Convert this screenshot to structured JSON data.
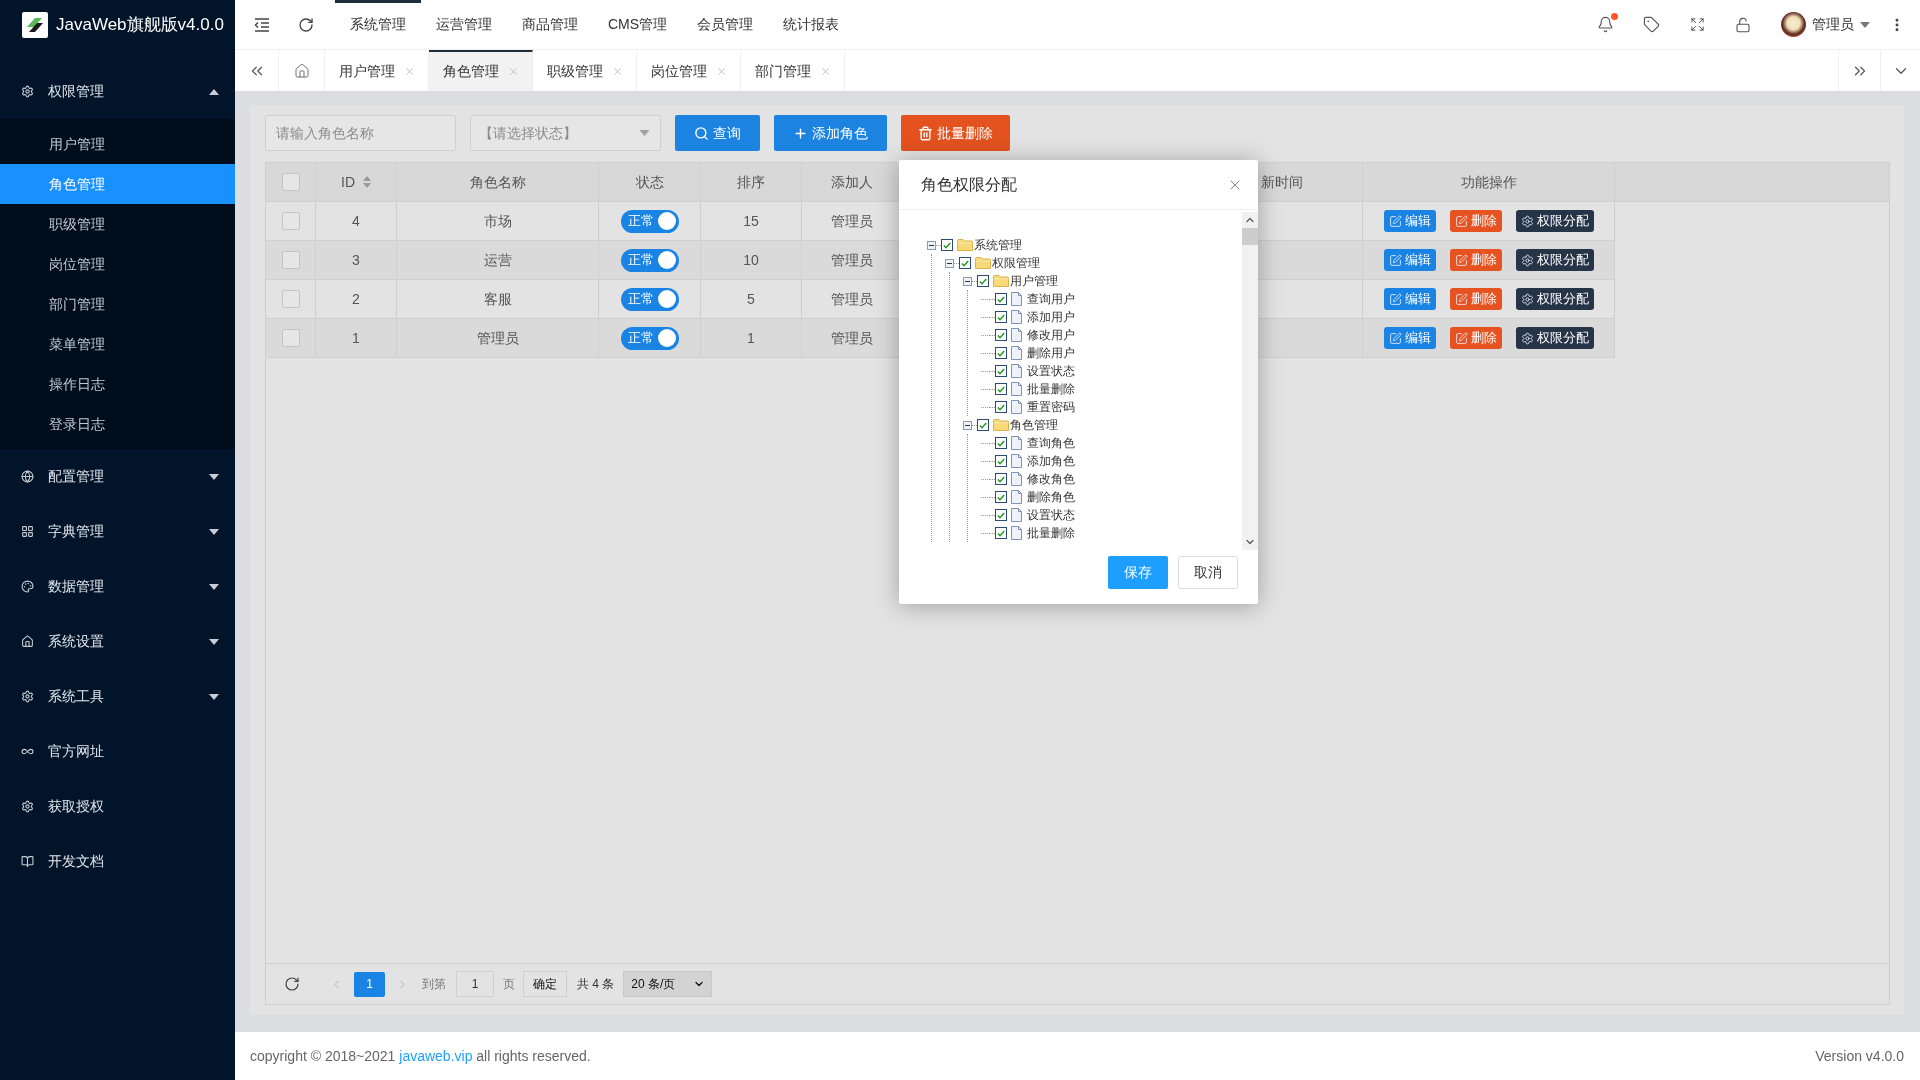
{
  "app": {
    "title": "JavaWeb旗舰版v4.0.0"
  },
  "sidebar": {
    "items": [
      {
        "label": "权限管理",
        "kind": "group",
        "expanded": true,
        "children": [
          {
            "label": "用户管理",
            "selected": false
          },
          {
            "label": "角色管理",
            "selected": true
          },
          {
            "label": "职级管理",
            "selected": false
          },
          {
            "label": "岗位管理",
            "selected": false
          },
          {
            "label": "部门管理",
            "selected": false
          },
          {
            "label": "菜单管理",
            "selected": false
          },
          {
            "label": "操作日志",
            "selected": false
          },
          {
            "label": "登录日志",
            "selected": false
          }
        ]
      },
      {
        "label": "配置管理",
        "kind": "group",
        "expanded": false
      },
      {
        "label": "字典管理",
        "kind": "group",
        "expanded": false
      },
      {
        "label": "数据管理",
        "kind": "group",
        "expanded": false
      },
      {
        "label": "系统设置",
        "kind": "group",
        "expanded": false
      },
      {
        "label": "系统工具",
        "kind": "group",
        "expanded": false
      },
      {
        "label": "官方网址",
        "kind": "link"
      },
      {
        "label": "获取授权",
        "kind": "link"
      },
      {
        "label": "开发文档",
        "kind": "link"
      }
    ]
  },
  "header": {
    "menu": [
      {
        "label": "系统管理",
        "selected": true
      },
      {
        "label": "运营管理",
        "selected": false
      },
      {
        "label": "商品管理",
        "selected": false
      },
      {
        "label": "CMS管理",
        "selected": false
      },
      {
        "label": "会员管理",
        "selected": false
      },
      {
        "label": "统计报表",
        "selected": false
      }
    ],
    "notifications": {
      "unread": true
    },
    "user": {
      "name": "管理员"
    }
  },
  "tabs": [
    {
      "label": "用户管理",
      "selected": false
    },
    {
      "label": "角色管理",
      "selected": true
    },
    {
      "label": "职级管理",
      "selected": false
    },
    {
      "label": "岗位管理",
      "selected": false
    },
    {
      "label": "部门管理",
      "selected": false
    }
  ],
  "toolbar": {
    "search": {
      "placeholder": "请输入角色名称"
    },
    "status": {
      "placeholder": "【请选择状态】"
    },
    "buttons": [
      {
        "label": "查询",
        "kind": "search"
      },
      {
        "label": "添加角色",
        "kind": "add"
      },
      {
        "label": "批量删除",
        "kind": "delete"
      }
    ]
  },
  "table": {
    "select_all": {
      "checked": false
    },
    "columns": [
      {
        "label": "ID",
        "sortable": true
      },
      {
        "label": "角色名称",
        "sortable": false
      },
      {
        "label": "状态",
        "sortable": false
      },
      {
        "label": "排序",
        "sortable": false
      },
      {
        "label": "添加人",
        "sortable": false
      },
      {
        "label": "新时间",
        "sortable": false
      },
      {
        "label": "功能操作",
        "sortable": false
      }
    ],
    "rows": [
      {
        "checked": false,
        "id": "4",
        "name": "市场",
        "status": {
          "label": "正常",
          "on": true
        },
        "sort": "15",
        "creator": "管理员",
        "actions": [
          {
            "label": "编辑",
            "kind": "edit"
          },
          {
            "label": "删除",
            "kind": "delete"
          },
          {
            "label": "权限分配",
            "kind": "permission"
          }
        ]
      },
      {
        "checked": false,
        "id": "3",
        "name": "运营",
        "status": {
          "label": "正常",
          "on": true
        },
        "sort": "10",
        "creator": "管理员",
        "actions": [
          {
            "label": "编辑",
            "kind": "edit"
          },
          {
            "label": "删除",
            "kind": "delete"
          },
          {
            "label": "权限分配",
            "kind": "permission"
          }
        ]
      },
      {
        "checked": false,
        "id": "2",
        "name": "客服",
        "status": {
          "label": "正常",
          "on": true
        },
        "sort": "5",
        "creator": "管理员",
        "actions": [
          {
            "label": "编辑",
            "kind": "edit"
          },
          {
            "label": "删除",
            "kind": "delete"
          },
          {
            "label": "权限分配",
            "kind": "permission"
          }
        ]
      },
      {
        "checked": false,
        "id": "1",
        "name": "管理员",
        "status": {
          "label": "正常",
          "on": true
        },
        "sort": "1",
        "creator": "管理员",
        "actions": [
          {
            "label": "编辑",
            "kind": "edit"
          },
          {
            "label": "删除",
            "kind": "delete"
          },
          {
            "label": "权限分配",
            "kind": "permission"
          }
        ]
      }
    ]
  },
  "pagination": {
    "prev_disabled": true,
    "pages": [
      {
        "label": "1",
        "selected": true
      }
    ],
    "next_disabled": true,
    "goto_label": "到第",
    "goto_value": "1",
    "page_unit": "页",
    "confirm": "确定",
    "total": "共 4 条",
    "page_size": "20 条/页"
  },
  "modal": {
    "title": "角色权限分配",
    "tree": [
      {
        "label": "系统管理",
        "checked": true,
        "expanded": true,
        "children": [
          {
            "label": "权限管理",
            "checked": true,
            "expanded": true,
            "children": [
              {
                "label": "用户管理",
                "checked": true,
                "expanded": true,
                "children": [
                  {
                    "label": "查询用户",
                    "checked": true
                  },
                  {
                    "label": "添加用户",
                    "checked": true
                  },
                  {
                    "label": "修改用户",
                    "checked": true
                  },
                  {
                    "label": "删除用户",
                    "checked": true
                  },
                  {
                    "label": "设置状态",
                    "checked": true
                  },
                  {
                    "label": "批量删除",
                    "checked": true
                  },
                  {
                    "label": "重置密码",
                    "checked": true
                  }
                ]
              },
              {
                "label": "角色管理",
                "checked": true,
                "expanded": true,
                "children": [
                  {
                    "label": "查询角色",
                    "checked": true
                  },
                  {
                    "label": "添加角色",
                    "checked": true
                  },
                  {
                    "label": "修改角色",
                    "checked": true
                  },
                  {
                    "label": "删除角色",
                    "checked": true
                  },
                  {
                    "label": "设置状态",
                    "checked": true
                  },
                  {
                    "label": "批量删除",
                    "checked": true
                  }
                ]
              }
            ]
          }
        ]
      }
    ],
    "buttons": [
      {
        "label": "保存",
        "kind": "primary"
      },
      {
        "label": "取消",
        "kind": "default"
      }
    ]
  },
  "footer": {
    "text_before": "copyright © 2018~2021",
    "link": "javaweb.vip",
    "text_after": "all rights reserved.",
    "version": "Version v4.0.0"
  }
}
